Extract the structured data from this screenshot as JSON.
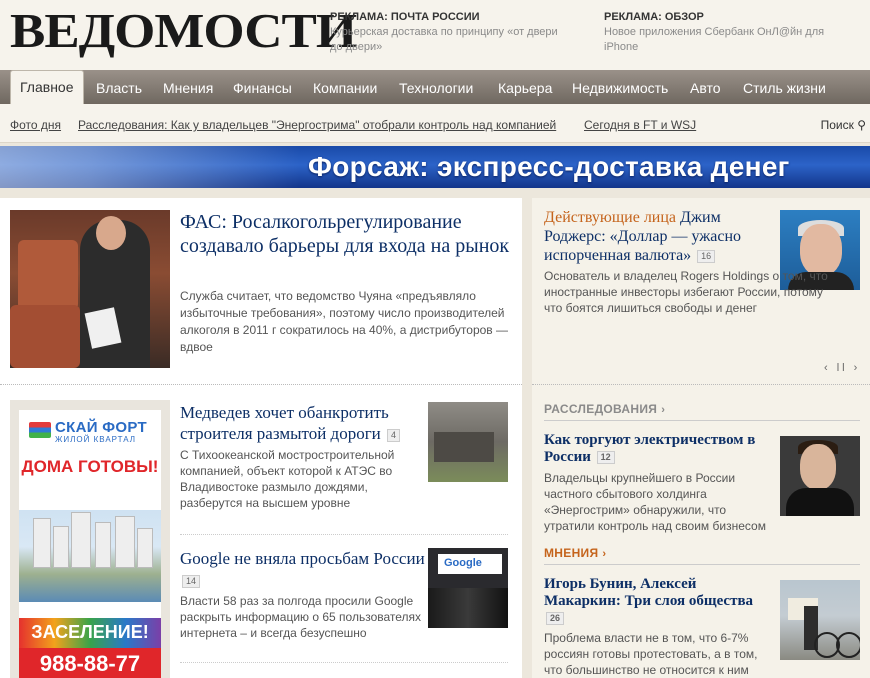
{
  "header": {
    "logo": "ВЕДОМОСТИ",
    "ads": [
      {
        "title": "РЕКЛАМА: ПОЧТА РОССИИ",
        "text": "Курьерская доставка по принципу «от двери до двери»"
      },
      {
        "title": "РЕКЛАМА: ОБЗОР",
        "text": "Новое приложения Сбербанк ОнЛ@йн для iPhone"
      }
    ]
  },
  "nav": {
    "items": [
      "Главное",
      "Власть",
      "Мнения",
      "Финансы",
      "Компании",
      "Технологии",
      "Карьера",
      "Недвижимость",
      "Авто",
      "Стиль жизни"
    ]
  },
  "subnav": {
    "links": [
      "Фото дня",
      "Расследования: Как у владельцев \"Энергострима\" отобрали контроль над компанией",
      "Сегодня в FT и WSJ"
    ],
    "search_label": "Поиск"
  },
  "banner": {
    "text": "Форсаж: экспресс-доставка денег"
  },
  "lead": {
    "title": "ФАС: Росалкогольрегулирование создавало барьеры для входа на рынок",
    "text": "Служба считает, что ведомство Чуяна «предъявляло избыточные требования», поэтому число производителей алкоголя в 2011 г сократилось на 40%, а дистрибуторов — вдвое"
  },
  "side_ad": {
    "brand": "СКАЙ ФОРТ",
    "brand_sub": "ЖИЛОЙ КВАРТАЛ",
    "headline": "ДОМА ГОТОВЫ!",
    "settle": "ЗАСЕЛЕНИЕ!",
    "phone": "988-88-77"
  },
  "news": [
    {
      "title": "Медведев хочет обанкротить строителя размытой дороги",
      "count": "4",
      "text": "С Тихоокеанской мостростроительной компанией, объект которой к АТЭС во Владивостоке размыло дождями, разберутся на высшем уровне"
    },
    {
      "title": "Google не вняла просьбам России",
      "count": "14",
      "text": "Власти 58 раз за полгода просили Google раскрыть информацию о 65 пользователях интернета – и всегда безуспешно"
    }
  ],
  "right": {
    "persons": {
      "rubric": "Действующие лица",
      "title": "Джим Роджерс: «Доллар — ужасно испорченная валюта»",
      "count": "16",
      "text": "Основатель и владелец Rogers Holdings о том, что иностранные инвесторы избегают России, потому что боятся лишиться свободы и денег",
      "pager": "‹ ll ›"
    },
    "investigations": {
      "section": "РАССЛЕДОВАНИЯ",
      "title": "Как торгуют электричеством в России",
      "count": "12",
      "text": "Владельцы крупнейшего в России частного сбытового холдинга «Энергострим» обнаружили, что утратили контроль над своим бизнесом"
    },
    "opinions": {
      "section": "МНЕНИЯ",
      "title": "Игорь Бунин, Алексей Макаркин: Три слоя общества",
      "count": "26",
      "text": "Проблема власти не в том, что 6-7% россиян готовы протестовать, а в том, что большинство не относится к ним"
    }
  },
  "colors": {
    "accent_orange": "#c5641c",
    "link_blue": "#0d2f66",
    "nav_bg": "#7d756d",
    "banner_blue": "#2c63c8"
  }
}
